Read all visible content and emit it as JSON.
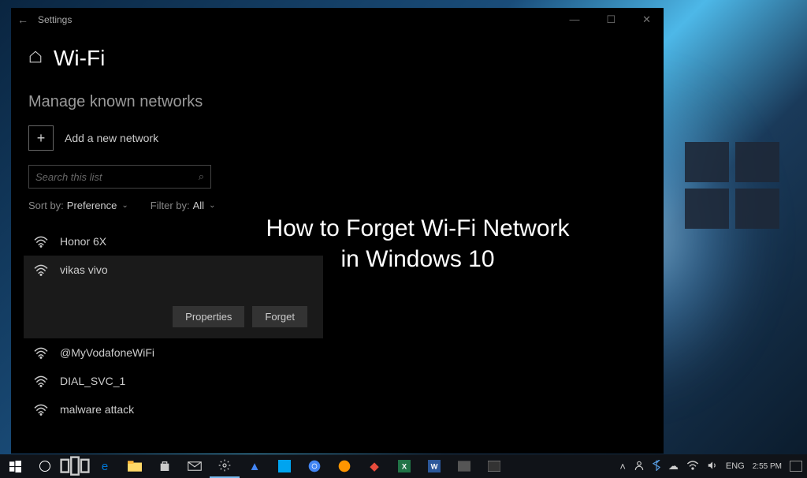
{
  "desktop": {
    "wallpaper": "windows-10-light-beam"
  },
  "settings_window": {
    "titlebar": {
      "title": "Settings",
      "minimize": "—",
      "maximize": "☐",
      "close": "✕"
    },
    "page_title": "Wi-Fi",
    "section_title": "Manage known networks",
    "add_network_label": "Add a new network",
    "search": {
      "placeholder": "Search this list"
    },
    "sort": {
      "label": "Sort by:",
      "value": "Preference"
    },
    "filter": {
      "label": "Filter by:",
      "value": "All"
    },
    "networks": [
      {
        "name": "Honor 6X",
        "selected": false
      },
      {
        "name": "vikas vivo",
        "selected": true
      },
      {
        "name": "@MyVodafoneWiFi",
        "selected": false
      },
      {
        "name": "DIAL_SVC_1",
        "selected": false
      },
      {
        "name": "malware attack",
        "selected": false
      }
    ],
    "actions": {
      "properties": "Properties",
      "forget": "Forget"
    }
  },
  "overlay": {
    "title_line1": "How to Forget Wi-Fi Network",
    "title_line2": "in Windows 10"
  },
  "taskbar": {
    "tray": {
      "language": "ENG",
      "time": "2:55 PM"
    }
  }
}
